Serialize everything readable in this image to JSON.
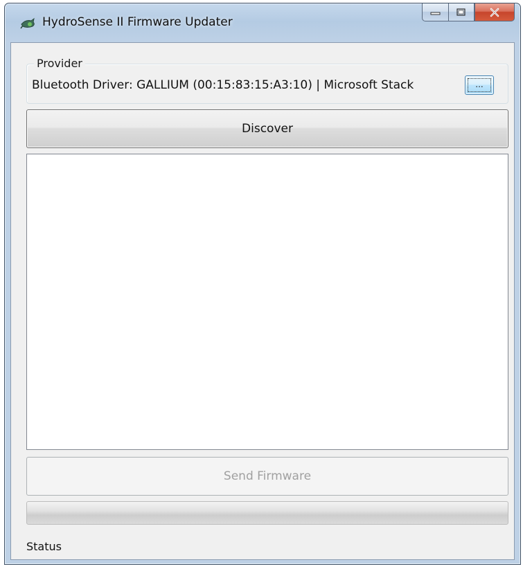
{
  "window": {
    "title": "HydroSense II Firmware Updater",
    "app_icon": "hydrosense-app-icon",
    "caption_buttons": [
      "minimize",
      "maximize",
      "close"
    ]
  },
  "provider": {
    "group_label": "Provider",
    "value": "Bluetooth Driver: GALLIUM (00:15:83:15:A3:10) | Microsoft Stack",
    "browse_label": "..."
  },
  "actions": {
    "discover_label": "Discover",
    "send_firmware_label": "Send Firmware",
    "send_firmware_enabled": false
  },
  "device_list": {
    "items": []
  },
  "progress": {
    "value": 0
  },
  "status": {
    "text": "Status"
  },
  "colors": {
    "close_button": "#c7452c",
    "browse_button_accent": "#3c7fb1",
    "client_background": "#f0f0f0"
  }
}
